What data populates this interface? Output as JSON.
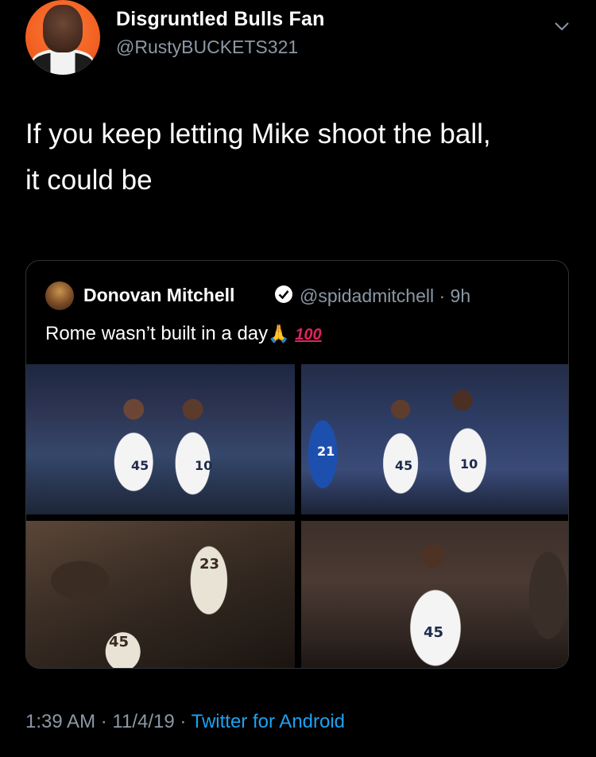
{
  "tweet": {
    "author": {
      "display_name": "Disgruntled Bulls Fan",
      "handle": "@RustyBUCKETS321",
      "avatar_icon": "crying-face-avatar"
    },
    "text_line1": "If you keep letting Mike shoot the ball,",
    "text_line2": "it could be",
    "timestamp": "1:39 AM",
    "date": "11/4/19",
    "separator": "·",
    "source": "Twitter for Android"
  },
  "quoted_tweet": {
    "display_name": "Donovan Mitchell",
    "verified_icon": "verified-badge-icon",
    "handle_time": "@spidadmitchell · 9h",
    "text": "Rome wasn’t built in a day",
    "emoji_pray": "🙏",
    "emoji_100": "100",
    "photos": [
      {
        "jersey_numbers": [
          "45",
          "10"
        ]
      },
      {
        "jersey_numbers": [
          "21",
          "45",
          "10"
        ]
      },
      {
        "jersey_numbers": [
          "23",
          "45"
        ]
      },
      {
        "jersey_numbers": [
          "45"
        ]
      }
    ]
  },
  "colors": {
    "background": "#000000",
    "secondary_text": "#8b98a5",
    "link": "#1da1f2",
    "border": "#2f3336"
  }
}
